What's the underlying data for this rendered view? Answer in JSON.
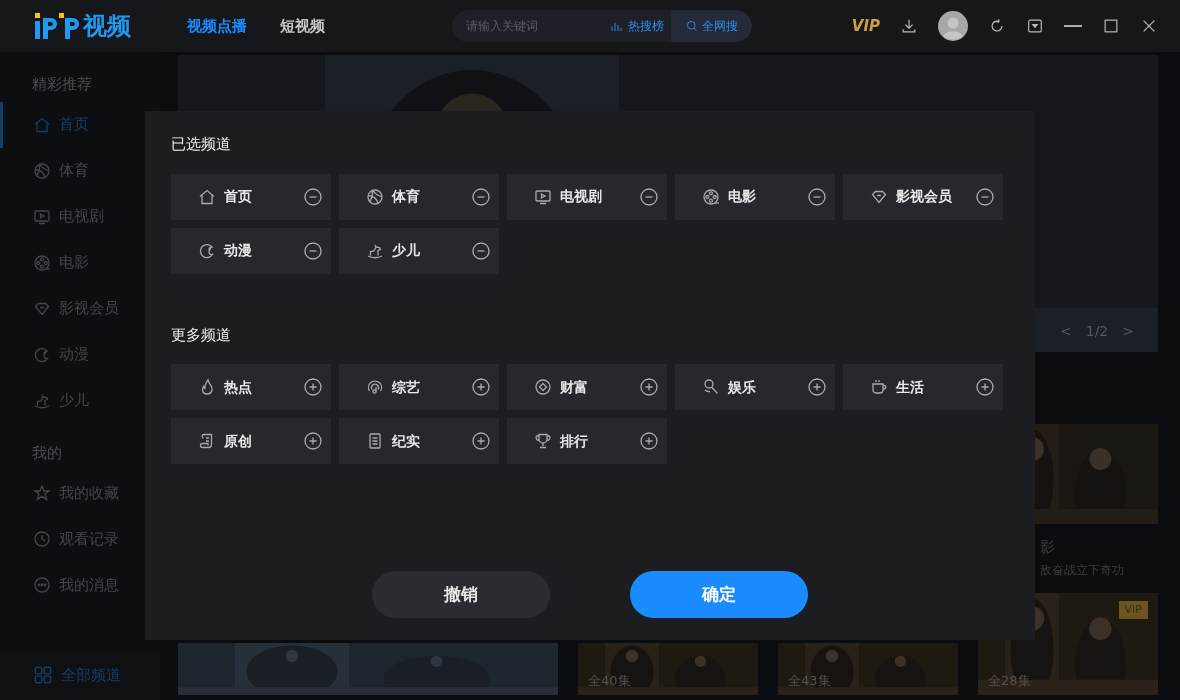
{
  "header": {
    "logo_text": "视频",
    "tabs": [
      {
        "label": "视频点播",
        "selected": true
      },
      {
        "label": "短视频",
        "selected": false
      }
    ],
    "search": {
      "placeholder": "请输入关键词",
      "hot": "热搜榜",
      "all": "全网搜"
    },
    "vip": "VIP"
  },
  "sidebar": {
    "sections": [
      {
        "title": "精彩推荐",
        "items": [
          {
            "label": "首页",
            "selected": true
          },
          {
            "label": "体育",
            "selected": false
          },
          {
            "label": "电视剧",
            "selected": false
          },
          {
            "label": "电影",
            "selected": false
          },
          {
            "label": "影视会员",
            "selected": false
          },
          {
            "label": "动漫",
            "selected": false
          },
          {
            "label": "少儿",
            "selected": false
          }
        ]
      },
      {
        "title": "我的",
        "items": [
          {
            "label": "我的收藏",
            "selected": false
          },
          {
            "label": "观看记录",
            "selected": false
          },
          {
            "label": "我的消息",
            "selected": false
          }
        ]
      }
    ],
    "footer": "全部频道"
  },
  "banner": {
    "prev": "<",
    "page": "1/2",
    "next": ">"
  },
  "side_card": {
    "title": "影",
    "subtitle": "敌奋战立下奇功"
  },
  "episode_cards": [
    {
      "episodes": "全40集"
    },
    {
      "episodes": "全43集"
    },
    {
      "episodes": "全28集",
      "badge": "VIP"
    }
  ],
  "dialog": {
    "sections": [
      {
        "title": "已选频道",
        "kind": "remove",
        "channels": [
          {
            "label": "首页"
          },
          {
            "label": "体育"
          },
          {
            "label": "电视剧"
          },
          {
            "label": "电影"
          },
          {
            "label": "影视会员"
          },
          {
            "label": "动漫"
          },
          {
            "label": "少儿"
          }
        ]
      },
      {
        "title": "更多频道",
        "kind": "add",
        "channels": [
          {
            "label": "热点"
          },
          {
            "label": "综艺"
          },
          {
            "label": "财富"
          },
          {
            "label": "娱乐"
          },
          {
            "label": "生活"
          },
          {
            "label": "原创"
          },
          {
            "label": "纪实"
          },
          {
            "label": "排行"
          }
        ]
      }
    ],
    "buttons": [
      {
        "label": "撤销",
        "kind": "secondary"
      },
      {
        "label": "确定",
        "kind": "primary"
      }
    ]
  }
}
